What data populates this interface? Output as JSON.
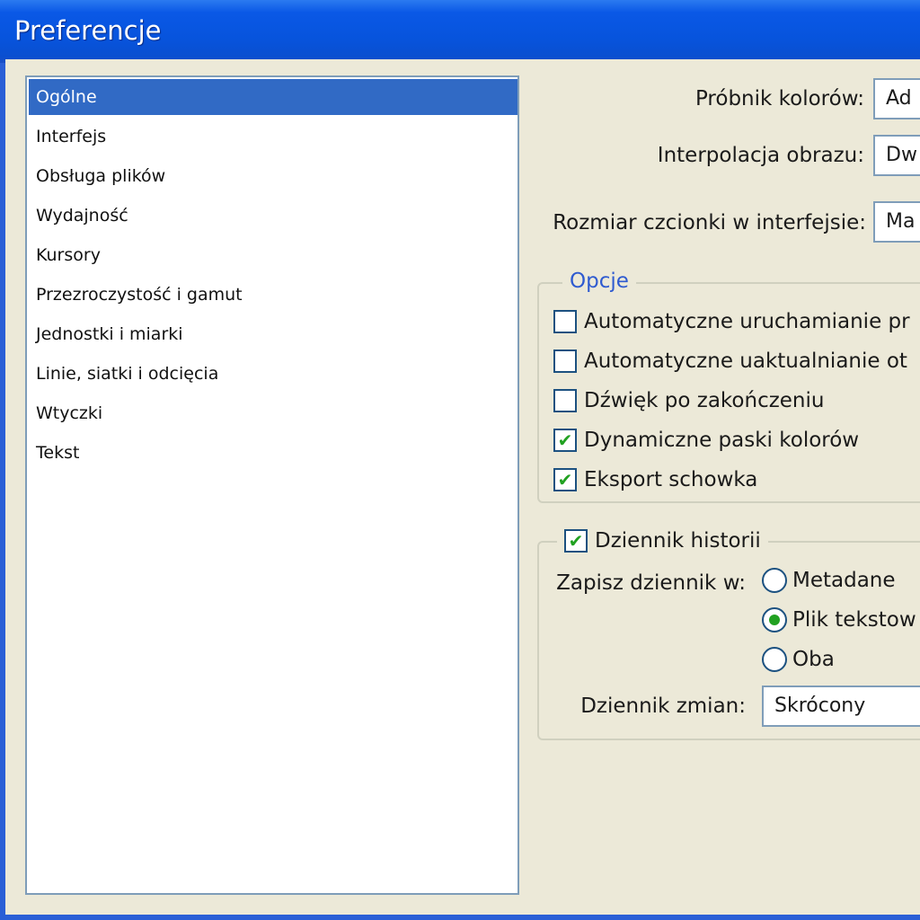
{
  "window": {
    "title": "Preferencje"
  },
  "sidebar": {
    "items": [
      {
        "label": "Ogólne",
        "selected": true
      },
      {
        "label": "Interfejs",
        "selected": false
      },
      {
        "label": "Obsługa plików",
        "selected": false
      },
      {
        "label": "Wydajność",
        "selected": false
      },
      {
        "label": "Kursory",
        "selected": false
      },
      {
        "label": "Przezroczystość i gamut",
        "selected": false
      },
      {
        "label": "Jednostki i miarki",
        "selected": false
      },
      {
        "label": "Linie, siatki i odcięcia",
        "selected": false
      },
      {
        "label": "Wtyczki",
        "selected": false
      },
      {
        "label": "Tekst",
        "selected": false
      }
    ]
  },
  "general": {
    "color_picker_label": "Próbnik kolorów:",
    "color_picker_value": "Ad",
    "interpolation_label": "Interpolacja obrazu:",
    "interpolation_value": "Dw",
    "font_size_label": "Rozmiar czcionki w interfejsie:",
    "font_size_value": "Ma"
  },
  "options": {
    "legend": "Opcje",
    "items": [
      {
        "label": "Automatyczne uruchamianie pr",
        "checked": false
      },
      {
        "label": "Automatyczne uaktualnianie ot",
        "checked": false
      },
      {
        "label": "Dźwięk po zakończeniu",
        "checked": false
      },
      {
        "label": "Dynamiczne paski kolorów",
        "checked": true
      },
      {
        "label": "Eksport schowka",
        "checked": true
      }
    ]
  },
  "history": {
    "legend": "Dziennik historii",
    "enabled": true,
    "save_label": "Zapisz dziennik w:",
    "radios": [
      {
        "label": "Metadane",
        "selected": false
      },
      {
        "label": "Plik tekstow",
        "selected": true
      },
      {
        "label": "Oba",
        "selected": false
      }
    ],
    "edit_log_label": "Dziennik zmian:",
    "edit_log_value": "Skrócony"
  },
  "colors": {
    "titlebar": "#0754dd",
    "selection": "#316ac5",
    "legend_text": "#2f5bd0",
    "check_mark": "#21a121"
  }
}
